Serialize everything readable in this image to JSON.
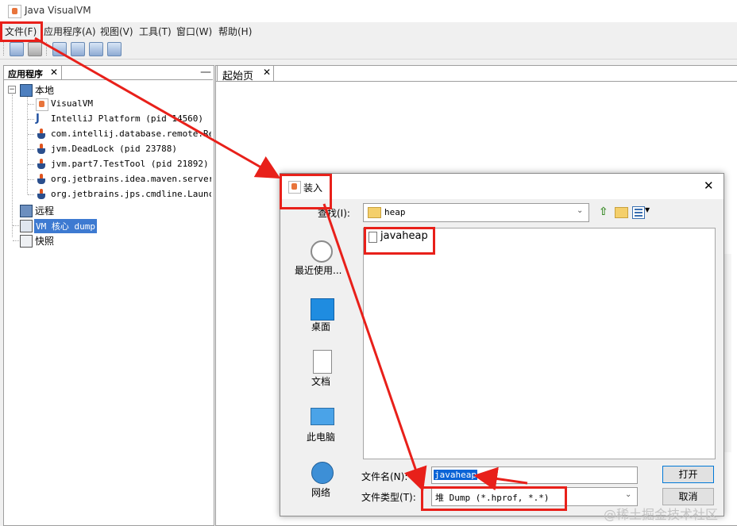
{
  "window": {
    "title": "Java VisualVM"
  },
  "menubar": {
    "items": [
      "文件(F)",
      "应用程序(A)",
      "视图(V)",
      "工具(T)",
      "窗口(W)",
      "帮助(H)"
    ]
  },
  "left_panel": {
    "tab_label": "应用程序",
    "close_glyph": "✕",
    "minimize_glyph": "—",
    "tree": {
      "local": "本地",
      "local_children": [
        "VisualVM",
        "IntelliJ Platform (pid 14560)",
        "com.intellij.database.remote.Remo",
        "jvm.DeadLock (pid 23788)",
        "jvm.part7.TestTool (pid 21892)",
        "org.jetbrains.idea.maven.server.Re",
        "org.jetbrains.jps.cmdline.Launcher"
      ],
      "remote": "远程",
      "coredump": "VM 核心 dump",
      "snapshots": "快照"
    }
  },
  "right_panel": {
    "tab_label": "起始页",
    "close_glyph": "✕"
  },
  "dialog": {
    "title": "装入",
    "close_glyph": "✕",
    "look_in_label": "查找(I):",
    "look_in_value": "heap",
    "places": [
      "最近使用...",
      "桌面",
      "文档",
      "此电脑",
      "网络"
    ],
    "files": [
      "javaheap"
    ],
    "file_name_label": "文件名(N):",
    "file_name_value": "javaheap",
    "file_type_label": "文件类型(T):",
    "file_type_value": "堆 Dump (*.hprof, *.*)",
    "open_button": "打开",
    "cancel_button": "取消"
  },
  "watermark": "@稀土掘金技术社区",
  "colors": {
    "annotation_red": "#e8201a",
    "selection_blue": "#3d7ad1"
  }
}
